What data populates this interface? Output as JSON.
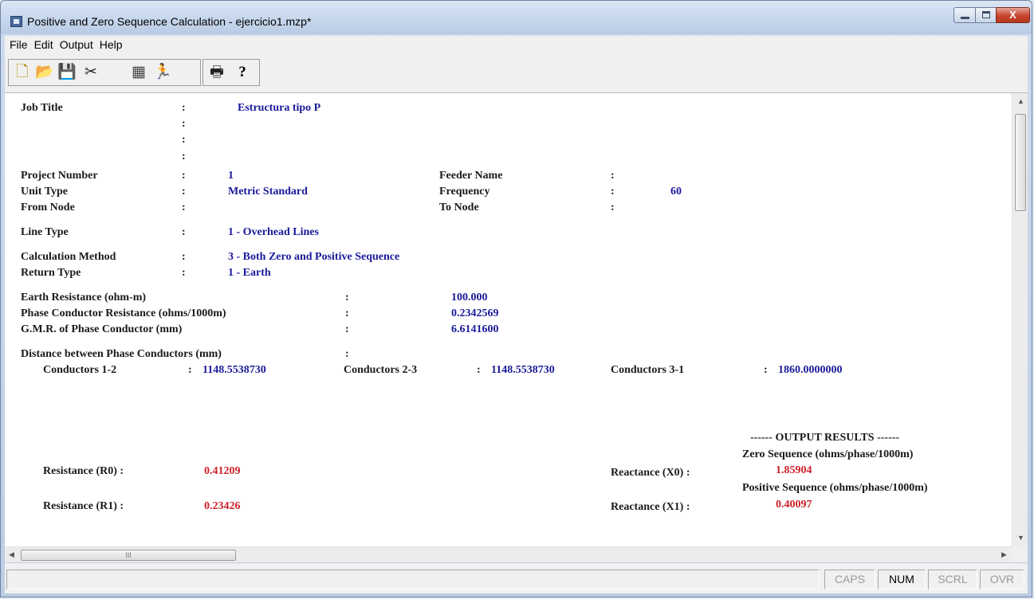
{
  "window": {
    "title": "Positive and Zero Sequence Calculation - ejercicio1.mzp*",
    "close_glyph": "X"
  },
  "menu": [
    "File",
    "Edit",
    "Output",
    "Help"
  ],
  "toolbar": {
    "buttons": [
      {
        "name": "new-icon",
        "glyph": "🗋"
      },
      {
        "name": "open-icon",
        "glyph": "📂"
      },
      {
        "name": "save-icon",
        "glyph": "💾"
      },
      {
        "name": "cut-icon",
        "glyph": "✂"
      },
      {
        "name": "calculator-icon",
        "glyph": "▦"
      },
      {
        "name": "run-icon",
        "glyph": "🏃"
      },
      {
        "name": "print-icon",
        "glyph": "🖶"
      },
      {
        "name": "help-icon",
        "glyph": "?"
      }
    ]
  },
  "report": {
    "colon": ":",
    "job_title_label": "Job Title",
    "job_title_value": "Estructura tipo P",
    "project_number_label": "Project Number",
    "project_number_value": "1",
    "feeder_name_label": "Feeder Name",
    "unit_type_label": "Unit Type",
    "unit_type_value": "Metric Standard",
    "frequency_label": "Frequency",
    "frequency_value": "60",
    "from_node_label": "From Node",
    "to_node_label": "To Node",
    "line_type_label": "Line Type",
    "line_type_value": "1 - Overhead Lines",
    "calc_method_label": "Calculation Method",
    "calc_method_value": "3 - Both Zero and Positive Sequence",
    "return_type_label": "Return Type",
    "return_type_value": "1 - Earth",
    "earth_resistance_label": "Earth Resistance (ohm-m)",
    "earth_resistance_value": "100.000",
    "phase_resistance_label": "Phase Conductor Resistance (ohms/1000m)",
    "phase_resistance_value": "0.2342569",
    "gmr_label": "G.M.R. of Phase Conductor (mm)",
    "gmr_value": "6.6141600",
    "distance_label": "Distance between Phase Conductors (mm)",
    "c12_label": "Conductors 1-2",
    "c12_value": "1148.5538730",
    "c23_label": "Conductors 2-3",
    "c23_value": "1148.5538730",
    "c31_label": "Conductors 3-1",
    "c31_value": "1860.0000000"
  },
  "output": {
    "header": "------ OUTPUT RESULTS ------",
    "zero_seq_label": "Zero Sequence (ohms/phase/1000m)",
    "r0_label": "Resistance (R0) :",
    "r0_value": "0.41209",
    "x0_label": "Reactance (X0) :",
    "x0_value": "1.85904",
    "pos_seq_label": "Positive Sequence (ohms/phase/1000m)",
    "r1_label": "Resistance (R1) :",
    "r1_value": "0.23426",
    "x1_label": "Reactance (X1) :",
    "x1_value": "0.40097"
  },
  "scroll": {
    "hthumb_grip": "III"
  },
  "status": {
    "message": "",
    "indicators": [
      {
        "label": "CAPS",
        "active": false
      },
      {
        "label": "NUM",
        "active": true
      },
      {
        "label": "SCRL",
        "active": false
      },
      {
        "label": "OVR",
        "active": false
      }
    ]
  }
}
